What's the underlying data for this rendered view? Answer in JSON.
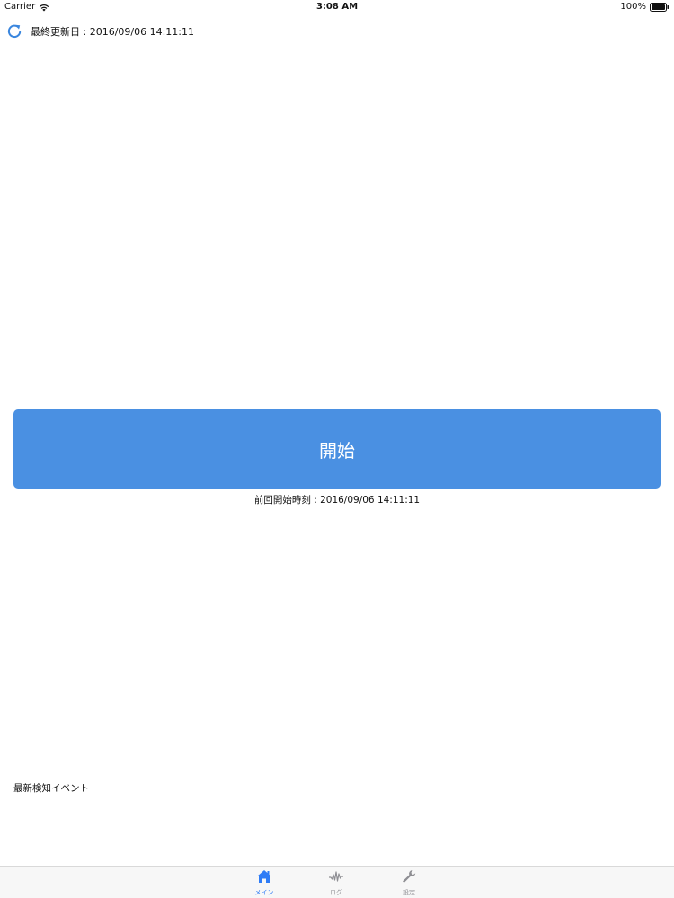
{
  "status_bar": {
    "carrier": "Carrier",
    "time": "3:08 AM",
    "battery": "100%"
  },
  "header": {
    "refresh_icon": "refresh-icon",
    "last_updated": "最終更新日 : 2016/09/06 14:11:11"
  },
  "main": {
    "start_button_label": "開始",
    "last_start_time": "前回開始時刻 : 2016/09/06 14:11:11",
    "events_heading": "最新検知イベント"
  },
  "tab_bar": {
    "tabs": [
      {
        "label": "メイン",
        "icon": "home-icon",
        "active": true
      },
      {
        "label": "ログ",
        "icon": "waveform-icon",
        "active": false
      },
      {
        "label": "設定",
        "icon": "wrench-icon",
        "active": false
      }
    ]
  },
  "colors": {
    "accent": "#4a90e2",
    "tab_active": "#2f7cf6",
    "tab_inactive": "#8e8e93"
  }
}
